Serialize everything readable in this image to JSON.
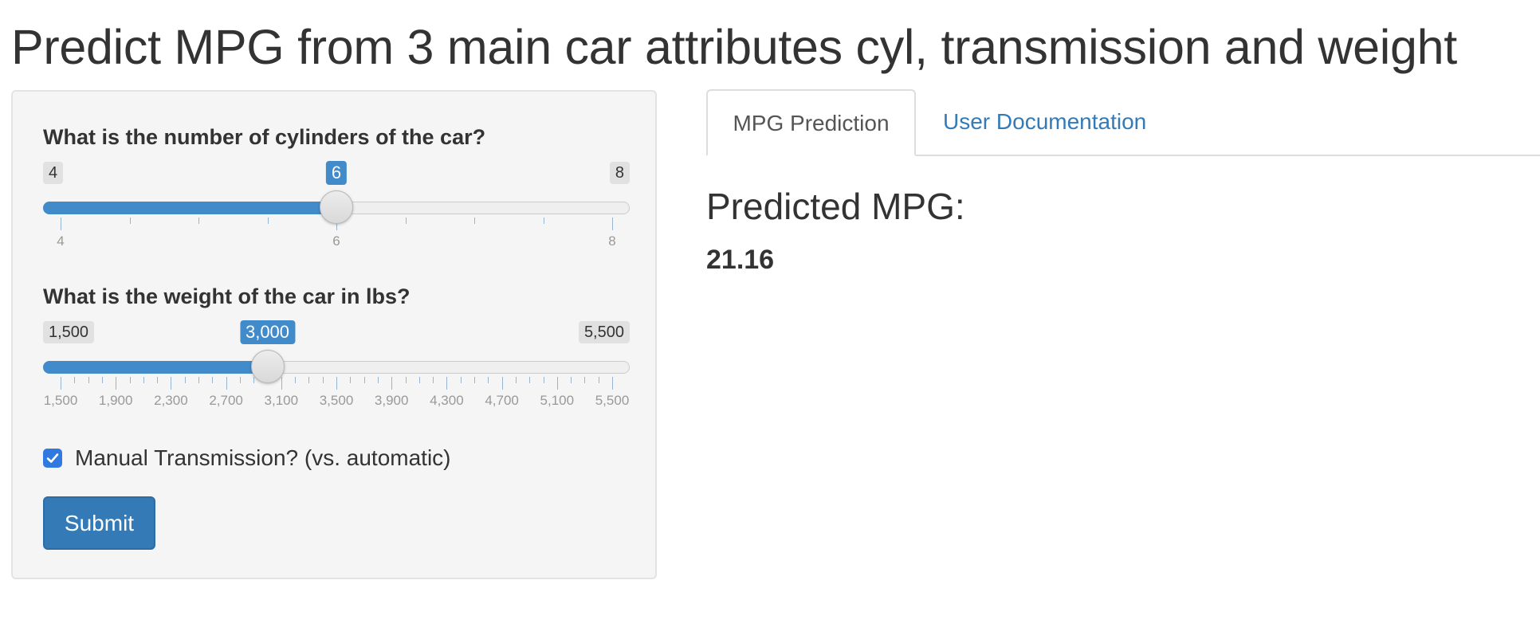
{
  "title": "Predict MPG from 3 main car attributes cyl, transmission and weight",
  "sidebar": {
    "cyl": {
      "label": "What is the number of cylinders of the car?",
      "min": 4,
      "max": 8,
      "value": 6,
      "min_label": "4",
      "max_label": "8",
      "value_label": "6",
      "major_ticks": [
        "4",
        "6",
        "8"
      ],
      "minor_ticks_per_interval": 4
    },
    "weight": {
      "label": "What is the weight of the car in lbs?",
      "min": 1500,
      "max": 5500,
      "value": 3000,
      "min_label": "1,500",
      "max_label": "5,500",
      "value_label": "3,000",
      "major_ticks": [
        "1,500",
        "1,900",
        "2,300",
        "2,700",
        "3,100",
        "3,500",
        "3,900",
        "4,300",
        "4,700",
        "5,100",
        "5,500"
      ],
      "minor_ticks_per_interval": 4
    },
    "transmission": {
      "label": "Manual Transmission? (vs. automatic)",
      "checked": true
    },
    "submit_label": "Submit"
  },
  "tabs": [
    {
      "label": "MPG Prediction",
      "active": true
    },
    {
      "label": "User Documentation",
      "active": false
    }
  ],
  "main": {
    "heading": "Predicted MPG:",
    "value": "21.16"
  },
  "colors": {
    "accent": "#428bca",
    "button": "#337ab7",
    "link": "#337ab7",
    "checkbox": "#2f79e0"
  }
}
